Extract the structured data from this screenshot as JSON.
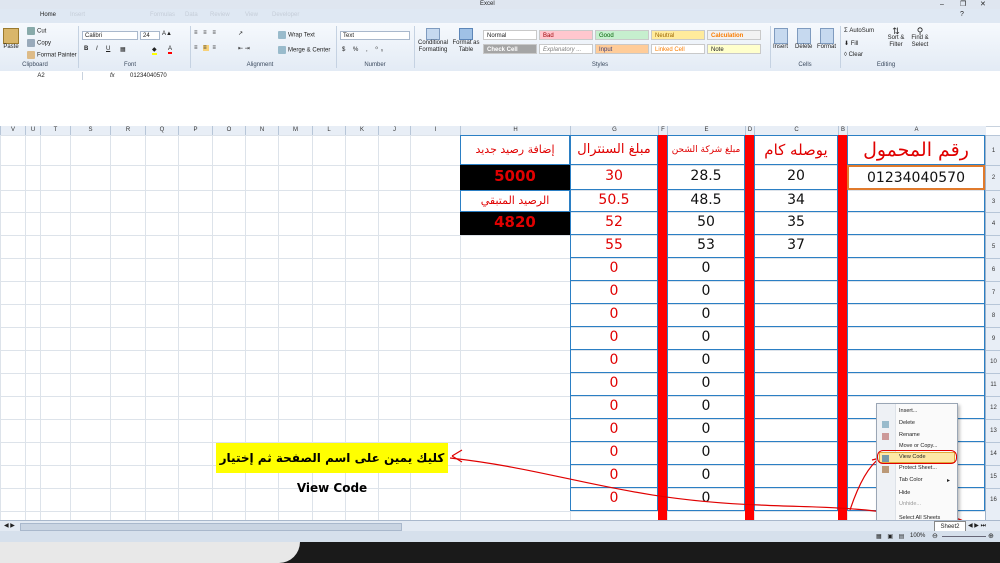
{
  "window": {
    "title": "Excel"
  },
  "tabs": [
    "Home",
    "Insert",
    "Page Layout",
    "Formulas",
    "Data",
    "Review",
    "View",
    "Developer"
  ],
  "clipboard": {
    "paste": "Paste",
    "cut": "Cut",
    "copy": "Copy",
    "painter": "Format Painter",
    "label": "Clipboard"
  },
  "font": {
    "name": "Calibri",
    "size": "24",
    "label": "Font"
  },
  "alignment": {
    "wrap": "Wrap Text",
    "merge": "Merge & Center",
    "label": "Alignment"
  },
  "number": {
    "format": "Text",
    "label": "Number"
  },
  "styles": {
    "items": [
      {
        "label": "Normal",
        "bg": "#ffffff"
      },
      {
        "label": "Bad",
        "bg": "#ffc7ce"
      },
      {
        "label": "Good",
        "bg": "#c6efce"
      },
      {
        "label": "Neutral",
        "bg": "#ffeb9c"
      },
      {
        "label": "Calculation",
        "bg": "#f2f2f2"
      },
      {
        "label": "Check Cell",
        "bg": "#a5a5a5"
      },
      {
        "label": "Explanatory ...",
        "bg": "#ffffff"
      },
      {
        "label": "Input",
        "bg": "#ffcc99"
      },
      {
        "label": "Linked Cell",
        "bg": "#ffffff"
      },
      {
        "label": "Note",
        "bg": "#ffffcc"
      }
    ],
    "cond": "Conditional Formatting",
    "astable": "Format as Table",
    "label": "Styles"
  },
  "cells_grp": {
    "insert": "Insert",
    "delete": "Delete",
    "format": "Format",
    "label": "Cells"
  },
  "editing": {
    "autosum": "AutoSum",
    "fill": "Fill",
    "clear": "Clear",
    "sort": "Sort & Filter",
    "find": "Find & Select",
    "label": "Editing"
  },
  "formula_bar": {
    "name_box": "A2",
    "content": "01234040570"
  },
  "columns": [
    "V",
    "U",
    "T",
    "S",
    "R",
    "Q",
    "P",
    "O",
    "N",
    "M",
    "L",
    "K",
    "J",
    "I",
    "H",
    "G",
    "F",
    "E",
    "D",
    "C",
    "B",
    "A"
  ],
  "rows": [
    "1",
    "2",
    "3",
    "4",
    "5",
    "6",
    "7",
    "8",
    "9",
    "10",
    "11",
    "12",
    "13",
    "14",
    "15",
    "16"
  ],
  "sheet": {
    "A1": "رقم المحمول",
    "C1": "يوصله كام",
    "E1": "مبلغ شركة الشحن",
    "G1": "مبلغ السنترال",
    "H1": "إضافة رصيد جديد",
    "A2": "01234040570",
    "C": [
      "20",
      "34",
      "35",
      "37"
    ],
    "E": [
      "28.5",
      "48.5",
      "50",
      "53",
      "0",
      "0",
      "0",
      "0",
      "0",
      "0",
      "0",
      "0",
      "0",
      "0",
      "0",
      "0"
    ],
    "G": [
      "30",
      "50.5",
      "52",
      "55",
      "0",
      "0",
      "0",
      "0",
      "0",
      "0",
      "0",
      "0",
      "0",
      "0",
      "0",
      "0"
    ],
    "H2": "5000",
    "H3": "الرصيد المتبقي",
    "H4": "4820"
  },
  "context_menu": [
    "Insert...",
    "Delete",
    "Rename",
    "Move or Copy...",
    "View Code",
    "Protect Sheet...",
    "Tab Color",
    "Hide",
    "Unhide...",
    "Select All Sheets"
  ],
  "annotation": "كليك يمين على اسم الصفحة ثم إختيار View Code",
  "sheet_tab": "Sheet2",
  "zoom": "100%",
  "colors": {
    "red": "#ff0000",
    "cellblue": "#2b7fc4",
    "darkred": "#e00000"
  }
}
